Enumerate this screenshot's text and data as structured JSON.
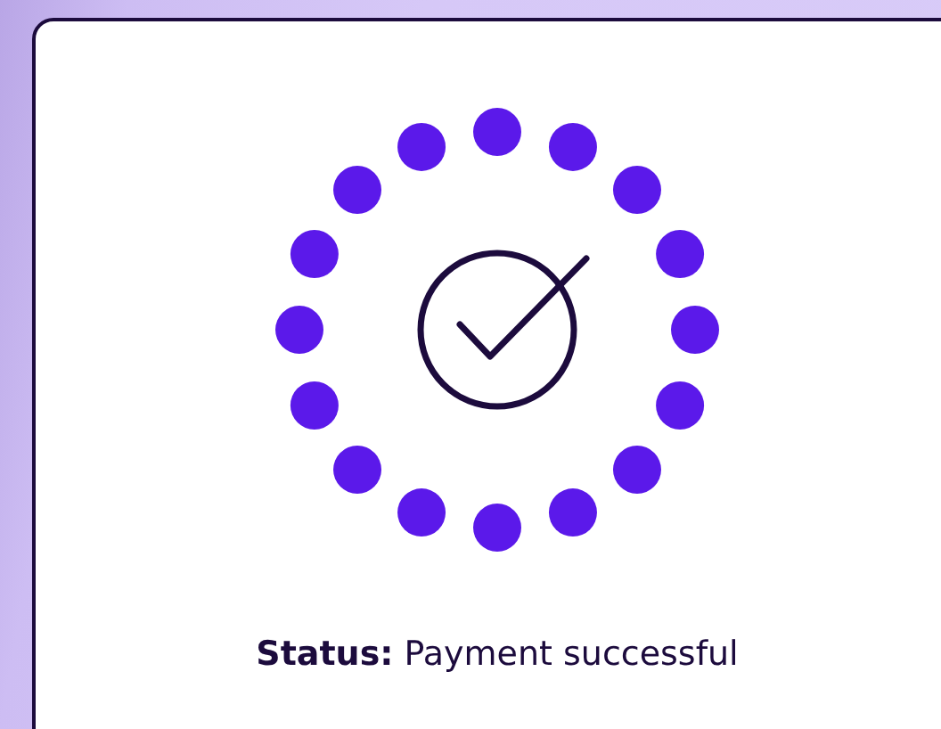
{
  "status": "**Status:** Payment successful"
}
